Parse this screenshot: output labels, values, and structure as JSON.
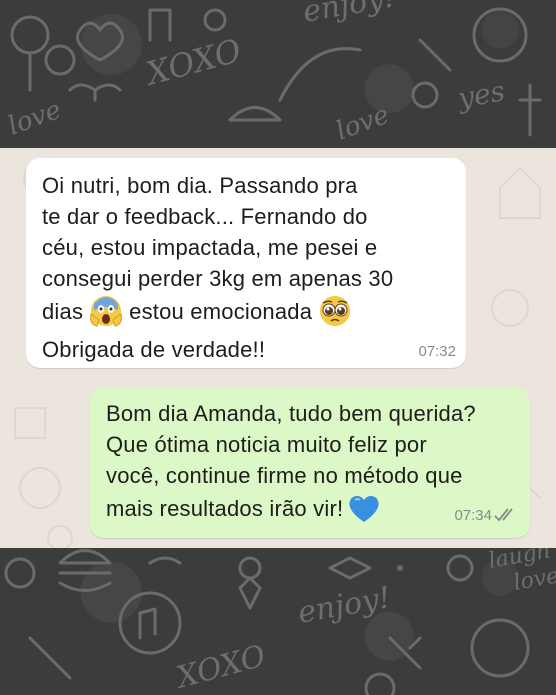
{
  "incoming_message": {
    "lines": [
      "Oi nutri, bom dia. Passando pra",
      "te dar o feedback... Fernando do",
      "céu, estou impactada, me pesei e",
      "consegui perder 3kg em apenas 30",
      "dias",
      "estou emocionada",
      "Obrigada de verdade!!"
    ],
    "emoji_1": "face-screaming-in-fear-icon",
    "emoji_2": "pleading-face-icon",
    "time": "07:32"
  },
  "outgoing_message": {
    "lines": [
      "Bom dia Amanda, tudo bem querida?",
      "Que ótima noticia muito feliz por",
      "você, continue firme no método que",
      "mais resultados irão vir!"
    ],
    "emoji": "blue-heart-icon",
    "time": "07:34",
    "status": "read-double-check-icon"
  },
  "wallpaper": {
    "top_words": [
      "enjoy!",
      "XOXO",
      "love",
      "yes",
      "love"
    ],
    "bottom_words": [
      "enjoy!",
      "XOXO",
      "laugh",
      "love"
    ]
  },
  "colors": {
    "incoming_bubble": "#ffffff",
    "outgoing_bubble": "#dcf8c6",
    "chat_background": "#ece5dd",
    "dark_wallpaper": "#3c3c3c",
    "read_ticks": "#8a8a8a",
    "heart": "#3b8fe0"
  }
}
